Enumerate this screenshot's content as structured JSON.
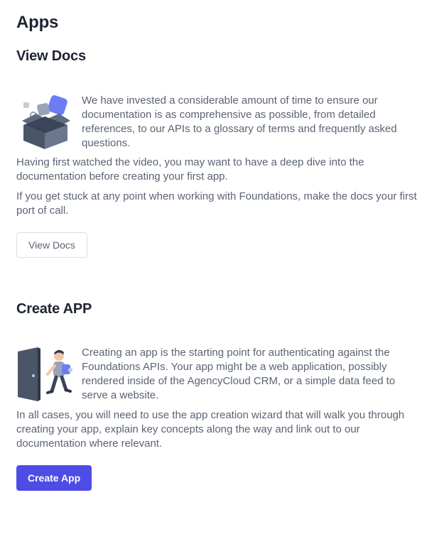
{
  "page": {
    "title": "Apps"
  },
  "docs_section": {
    "title": "View Docs",
    "illustration_icon": "open-box-icon",
    "intro": "We have invested a considerable amount of time to ensure our documentation is as comprehensive as possible, from detailed references, to our APIs to a glossary of terms and frequently asked questions.",
    "paragraph_1": "Having first watched the video, you may want to have a deep dive into the documentation before creating your first app.",
    "paragraph_2": "If you get stuck at any point when working with Foundations, make the docs your first port of call.",
    "button_label": "View Docs"
  },
  "create_section": {
    "title": "Create APP",
    "illustration_icon": "person-through-door-icon",
    "intro": "Creating an app is the starting point for authenticating against the Foundations APIs. Your app might be a web application, possibly rendered inside of the AgencyCloud CRM, or a simple data feed to serve a website.",
    "paragraph_1": "In all cases, you will need to use the app creation wizard that will walk you through creating your app, explain key concepts along the way and link out to our documentation where relevant.",
    "button_label": "Create App"
  },
  "colors": {
    "primary": "#4d4de6",
    "heading": "#1f2433",
    "body_text": "#5b6373",
    "illustration_dark": "#4a5568",
    "illustration_accent": "#6b7cf5"
  }
}
